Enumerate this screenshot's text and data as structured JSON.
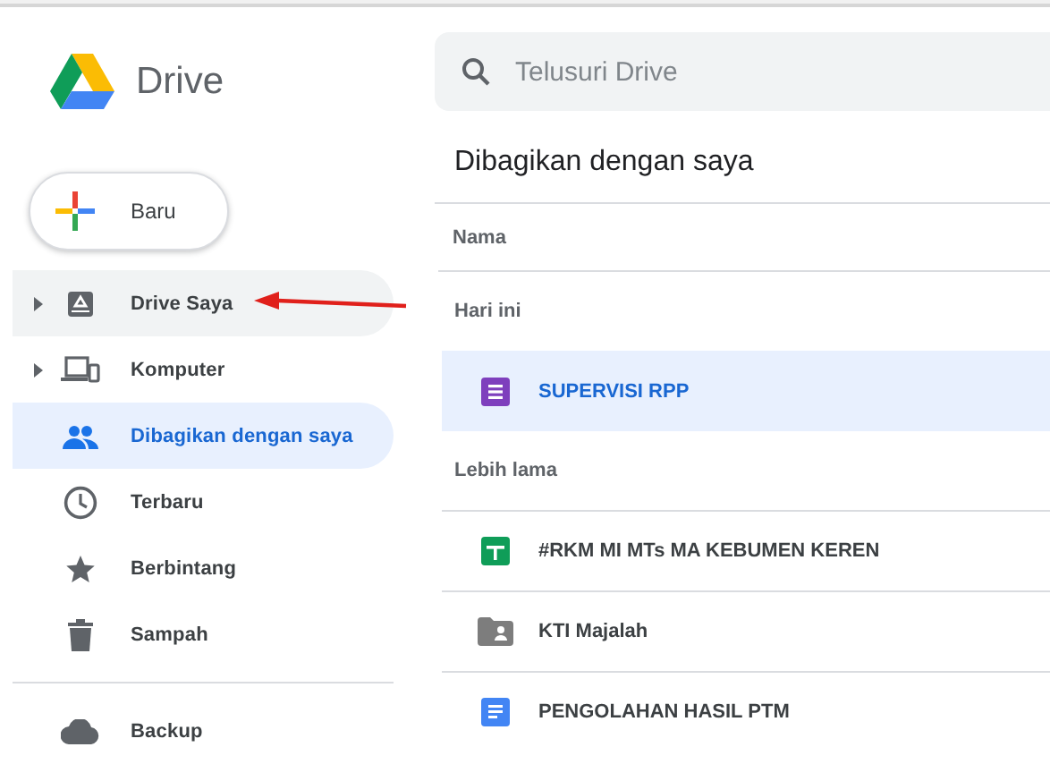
{
  "app": {
    "title": "Drive"
  },
  "new_button": {
    "label": "Baru"
  },
  "sidebar": {
    "items": [
      {
        "kind": "my-drive",
        "label": "Drive Saya",
        "expandable": true,
        "selected": false,
        "hovered": true
      },
      {
        "kind": "computers",
        "label": "Komputer",
        "expandable": true,
        "selected": false,
        "hovered": false
      },
      {
        "kind": "shared",
        "label": "Dibagikan dengan saya",
        "expandable": false,
        "selected": true,
        "hovered": false
      },
      {
        "kind": "recent",
        "label": "Terbaru",
        "expandable": false,
        "selected": false,
        "hovered": false
      },
      {
        "kind": "starred",
        "label": "Berbintang",
        "expandable": false,
        "selected": false,
        "hovered": false
      },
      {
        "kind": "trash",
        "label": "Sampah",
        "expandable": false,
        "selected": false,
        "hovered": false
      }
    ],
    "footer_items": [
      {
        "kind": "backup",
        "label": "Backup",
        "selected": false
      }
    ]
  },
  "search": {
    "placeholder": "Telusuri Drive"
  },
  "page_title": "Dibagikan dengan saya",
  "table": {
    "columns": [
      "Nama"
    ],
    "groups": [
      {
        "label": "Hari ini",
        "rows": [
          {
            "kind": "form",
            "name": "SUPERVISI RPP",
            "selected": true
          }
        ]
      },
      {
        "label": "Lebih lama",
        "rows": [
          {
            "kind": "sheet",
            "name": "#RKM MI MTs MA KEBUMEN KEREN",
            "selected": false
          },
          {
            "kind": "shared-folder",
            "name": "KTI Majalah",
            "selected": false
          },
          {
            "kind": "doc",
            "name": "PENGOLAHAN HASIL PTM",
            "selected": false
          }
        ]
      }
    ]
  }
}
